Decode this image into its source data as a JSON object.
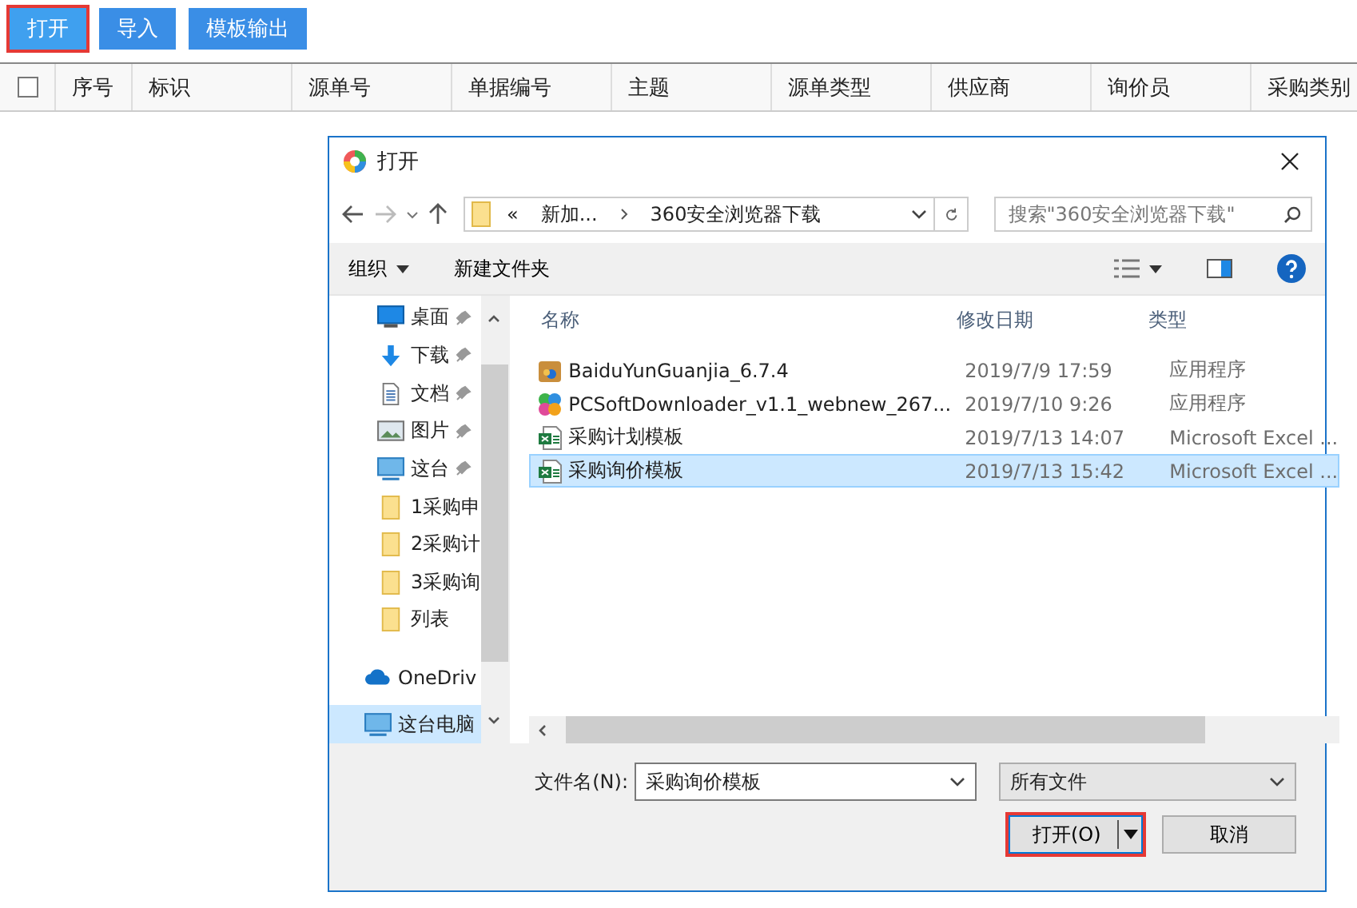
{
  "toolbar": {
    "buttons": [
      {
        "label": "打开",
        "highlighted": true
      },
      {
        "label": "导入",
        "highlighted": false
      },
      {
        "label": "模板输出",
        "highlighted": false
      }
    ]
  },
  "table": {
    "select_all_checked": false,
    "columns": [
      "序号",
      "标识",
      "源单号",
      "单据编号",
      "主题",
      "源单类型",
      "供应商",
      "询价员",
      "采购类别"
    ]
  },
  "dialog": {
    "title": "打开",
    "address": {
      "overflow": "«",
      "crumbs": [
        "新加...",
        "360安全浏览器下载"
      ]
    },
    "search": {
      "placeholder": "搜索\"360安全浏览器下载\""
    },
    "commands": {
      "organize": "组织",
      "new_folder": "新建文件夹"
    },
    "nav_items": [
      {
        "kind": "desktop",
        "label": "桌面",
        "pinned": true,
        "selected": false
      },
      {
        "kind": "download",
        "label": "下载",
        "pinned": true,
        "selected": false
      },
      {
        "kind": "document",
        "label": "文档",
        "pinned": true,
        "selected": false
      },
      {
        "kind": "picture",
        "label": "图片",
        "pinned": true,
        "selected": false
      },
      {
        "kind": "computer",
        "label": "这台",
        "pinned": true,
        "selected": false
      },
      {
        "kind": "folder",
        "label": "1采购申",
        "pinned": false,
        "selected": false
      },
      {
        "kind": "folder",
        "label": "2采购计",
        "pinned": false,
        "selected": false
      },
      {
        "kind": "folder",
        "label": "3采购询",
        "pinned": false,
        "selected": false
      },
      {
        "kind": "folder",
        "label": "列表",
        "pinned": false,
        "selected": false
      },
      {
        "kind": "cloud",
        "label": "OneDriv",
        "pinned": false,
        "selected": false
      },
      {
        "kind": "computer_root",
        "label": "这台电脑",
        "pinned": false,
        "selected": true
      }
    ],
    "columns": [
      "名称",
      "修改日期",
      "类型"
    ],
    "files": [
      {
        "kind": "package",
        "name": "BaiduYunGuanjia_6.7.4",
        "date": "2019/7/9 17:59",
        "type": "应用程序",
        "selected": false
      },
      {
        "kind": "app",
        "name": "PCSoftDownloader_v1.1_webnew_267...",
        "date": "2019/7/10 9:26",
        "type": "应用程序",
        "selected": false
      },
      {
        "kind": "excel",
        "name": "采购计划模板",
        "date": "2019/7/13 14:07",
        "type": "Microsoft Excel ...",
        "selected": false
      },
      {
        "kind": "excel",
        "name": "采购询价模板",
        "date": "2019/7/13 15:42",
        "type": "Microsoft Excel ...",
        "selected": true
      }
    ],
    "filename_label": "文件名(N):",
    "filename": "采购询价模板",
    "filter": "所有文件",
    "buttons": [
      {
        "kind": "split",
        "label": "打开(O)",
        "highlighted": true
      },
      {
        "kind": "plain",
        "label": "取消",
        "highlighted": false
      }
    ]
  }
}
